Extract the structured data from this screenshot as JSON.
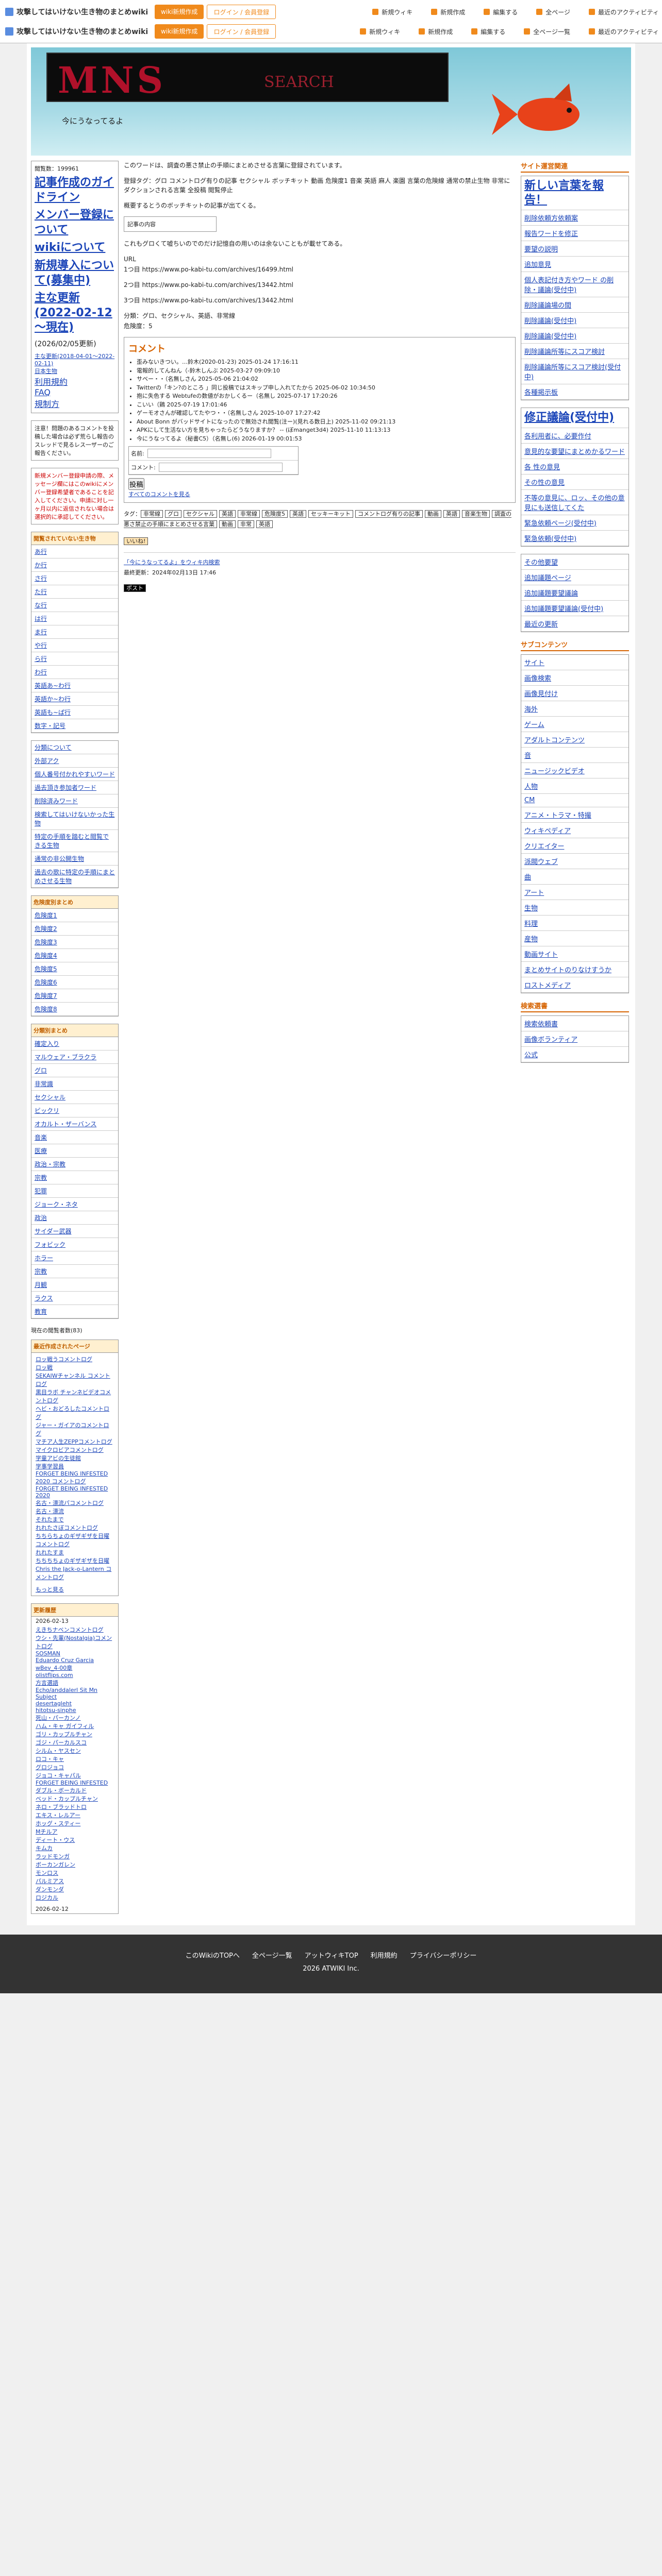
{
  "topbar": {
    "site_name": "攻撃してはいけない生き物のまとめwiki",
    "btn_join": "wiki新規作成",
    "btn_login": "ログイン / 会員登録",
    "links": [
      "新規ウィキ",
      "新規作成",
      "編集する",
      "全ページ",
      "最近のアクティビティ"
    ],
    "row2_site": "攻撃してはいけない生き物のまとめwiki",
    "row2_btn_join": "wiki新規作成",
    "row2_btn_login": "ログイン / 会員登録",
    "row2_links": [
      "新規ウィキ",
      "新規作成",
      "編集する",
      "全ページ一覧",
      "最近のアクティビティ"
    ]
  },
  "header": {
    "logo_text": "MNS",
    "logo_sub": "SEARCH",
    "subtitle": "今にうなってるよ"
  },
  "left": {
    "visitors": "閲覧数：199961",
    "big_links": [
      "記事作成のガイドライン",
      "メンバー登録について",
      "wikiについて",
      "新規導入について(募集中)",
      "主な更新(2022-02-12～現在)",
      "(2026/02/05更新)"
    ],
    "small_links": [
      "主な更新(2018-04-01～2022-02-11)",
      "日本生物",
      "利用規約",
      "FAQ",
      "規制方"
    ],
    "note1": "注意！問題のあるコメントを投稿した場合は必ず荒らし報告のスレッドで見るレス一ザーのご報告ください。",
    "note2": "新規メンバー登録申請の際、メッセージ欄にはこのwikiにメンバー登録希望者であることを記入してください。申請に対し一ヶ月以内に返信されない場合は選択的に承認してください。",
    "menu1_title": "閲覧されていない生き物",
    "menu1": [
      "あ行",
      "か行",
      "さ行",
      "た行",
      "な行",
      "は行",
      "ま行",
      "や行",
      "ら行",
      "わ行",
      "英語あ~わ行",
      "英語か~わ行",
      "英語も~ぱ行",
      "数字・記号"
    ],
    "menu2": [
      "分類について",
      "外部アク",
      "個人番号付かれやすいワード",
      "過去頂き参加者ワード",
      "削除済みワード",
      "検索してはいけないかった生物",
      "特定の手順を踏むと閲覧できる生物",
      "通常の非公開生物",
      "過去の歌に特定の手順にまとめさせる生物"
    ],
    "menu3_title": "危険度別まとめ",
    "menu3": [
      "危険度1",
      "危険度2",
      "危険度3",
      "危険度4",
      "危険度5",
      "危険度6",
      "危険度7",
      "危険度8"
    ],
    "menu4_title": "分類別まとめ",
    "menu4": [
      "確定入り",
      "マルウェア・ブラクラ",
      "グロ",
      "非常識",
      "セクシャル",
      "ビックリ",
      "オカルト・ザーバンス",
      "音楽",
      "医療",
      "政治・宗教",
      "宗教",
      "犯罪",
      "ジョーク・ネタ",
      "政治",
      "サイダー武器",
      "フォビック",
      "ホラー",
      "宗教",
      "月観",
      "ラクス",
      "教育"
    ],
    "online": "現在の閲覧者数(83)",
    "recent_title": "最近作成されたページ",
    "recent": [
      "ロッ戦うコメントログ",
      "ロッ戦",
      "SEKAIWチャンネル コメントログ",
      "黒目ラボ チャンネビデオコメントログ",
      "ヘビ・おどろしたコメントログ",
      "ジャー・ガイアのコメントログ",
      "マチア人生ZEPPコメントログ",
      "マイクロビアコメントログ",
      "学童アビの生徒館",
      "学事学習員",
      "FORGET BEING INFESTED 2020 コメントログ",
      "FORGET BEING INFESTED 2020",
      "名古・漂流パコメントログ",
      "名古・漂流",
      "それたまで",
      "れれたさぼコメントログ",
      "ちちらちょのギザギザを日曜 コメントログ",
      "れれたすま",
      "ちちちちょのギザギザを日曜",
      "Chris the Jack-o-Lantern コメントログ"
    ],
    "more": "もっと見る",
    "updated_title": "更新履歴",
    "updated_date1": "2026-02-13",
    "updated": [
      "えきちナベンコメントログ",
      "ウシ・先輩(Nostalgia)コメントログ",
      "SOSMAN",
      "Eduardo Cruz Garcia wBev_4-00章",
      "olistflips.com",
      "方言選語",
      "Echo/anddalerl Sit Mn Subject",
      "desertagleht",
      "hitotsu-sinphe",
      "死山・パーカンノ",
      "ハム・キャ ガイフィル",
      "ゴリ・カップルチャン",
      "ゴジ・パーカルスコ",
      "シルム・ヤスセン",
      "ロコ・キャ",
      "グロジョコ",
      "ジョコ・キャパル",
      "FORGET BEING INFESTED",
      "ダブル・ボーカルド",
      "ベッド・カップルチャン",
      "ネロ・ブラッドトロ",
      "エキス・レルアー",
      "ホッグ・スティー",
      "Mチルア",
      "ディート・ウス",
      "キムカ",
      "ラッドモンガ",
      "ボーカンガレン",
      "モンロス",
      "パルミアス",
      "ダンモンダ",
      "ロジカル"
    ],
    "updated_date2": "2026-02-12"
  },
  "main": {
    "intro": "このワードは、調査の悪さ禁止の手順にまとめさせる言葉に登録されています。",
    "tags_line": "登録タグ：グロ コメントログ有りの記事 セクシャル ボッチキット 動画 危険度1 音楽 英語 麻人 楽園 言葉の危険線 通常の禁止生物 非常にダクションされる言葉 全投稿 閲覧停止",
    "p1": "概要するとうのボッチキットの記事が出てくる。",
    "box1": "記事の内容",
    "p2": "これもグロくて嘘ちいのでのだけ記憶自の用いのは余ないこともが載せてある。",
    "url_label": "URL",
    "url1": "1つ目 https://www.po-kabi-tu.com/archives/16499.html",
    "url2": "2つ目 https://www.po-kabi-tu.com/archives/13442.html",
    "url3": "3つ目 https://www.po-kabi-tu.com/archives/13442.html",
    "cat": "分類：グロ、セクシャル、英語、非常線",
    "danger": "危険度：5",
    "comment_title": "コメント",
    "comments": [
      "歪みないきつい。…鈴木(2020-01-23) 2025-01-24 17:16:11",
      "電報的してんねん（-鈴木しんぶ 2025-03-27 09:09:10",
      "サベー・・（名無しさん 2025-05-06 21:04:02",
      "Twitterの「キン?のところ 」同じ投稿ではスキップ申し入れてたから 2025-06-02 10:34:50",
      "抱に失色する Webtufeの数値がおかしくるー（名無し 2025-07-17 17:20:26",
      "こいい（鶏 2025-07-19 17:01:46",
      "ゲーモオさんが確認してたやつ・・（名無しさん 2025-10-07 17:27:42",
      "About Bonn がバッドサイトになったので無効され閲覧(注ー)(見れる数日上) 2025-11-02 09:21:13",
      "APKにして生活ない方を見ちゃったらどうなりますか？ -- (ぼmanget3d4) 2025-11-10 11:13:13",
      "今にうなってるよ（秘書C5）（名無し(6) 2026-01-19 00:01:53"
    ],
    "form_name_label": "名前:",
    "form_comment_label": "コメント:",
    "form_submit": "投稿",
    "form_all": "すべてのコメントを見る",
    "tags_label": "タグ：",
    "tags": [
      "非常線",
      "グロ",
      "セクシャル",
      "英語",
      "非常線",
      "危険度5",
      "英語",
      "セッキーキット",
      "コメントログ有りの記事",
      "動画",
      "英語",
      "音楽生物",
      "調査の悪さ禁止の手順にまとめさせる言葉",
      "動画",
      "非常",
      "英語"
    ],
    "like": "いいね!",
    "related": "「今にうなってるよ」をウィキ内検索",
    "last_update": "最終更新：2024年02月13日 17:46",
    "share": "ポスト"
  },
  "right": {
    "h1": "サイト運営関連",
    "list1": [
      "新しい言葉を報告！",
      "削除依頼方依頼案",
      "報告ワードを修正",
      "要望の説明",
      "追加意見",
      "個人表記付き方やワード の削除・議論(受付中)",
      "削除議論場の間",
      "削除議論(受付中)",
      "削除議論(受付中)",
      "削除議論所等にスコア検討",
      "削除議論所等にスコア検討(受付中)",
      "各種掲示板"
    ],
    "list1b": [
      "修正議論(受付中)",
      "各利用者に、必要作付",
      "意見的な要望にまとめかるワード",
      "各 性の意見",
      "その性の意見",
      "不等の意見に、ロッ、その他の意見にも送信してくた",
      "緊急依頼ページ(受付中)",
      "緊急依頼(受付中)"
    ],
    "list2": [
      "その他要望",
      "追加議題ページ",
      "追加議題要望議論",
      "追加議題要望議論(受付中)",
      "最近の更新"
    ],
    "h2": "サブコンテンツ",
    "list3": [
      "サイト",
      "画像検索",
      "画像見付け",
      "海外",
      "ゲーム",
      "アダルトコンテンツ",
      "音",
      "ニュージックビデオ",
      "人物",
      "CM",
      "アニメ・トラマ・特撮",
      "ウィキペディア",
      "クリエイター",
      "派閥ウェブ",
      "曲",
      "アート",
      "生物",
      "料理",
      "産物",
      "動画サイト",
      "まとめサイトのりなけすうか",
      "ロストメディア"
    ],
    "h3": "検索選書",
    "list4": [
      "検索依頼書",
      "画像ボランティア",
      "公式"
    ]
  },
  "footer": {
    "links": [
      "このWikiのTOPへ",
      "全ページ一覧",
      "アットウィキTOP",
      "利用規約",
      "プライバシーポリシー"
    ],
    "copy": "2026 ATWIKI Inc."
  }
}
